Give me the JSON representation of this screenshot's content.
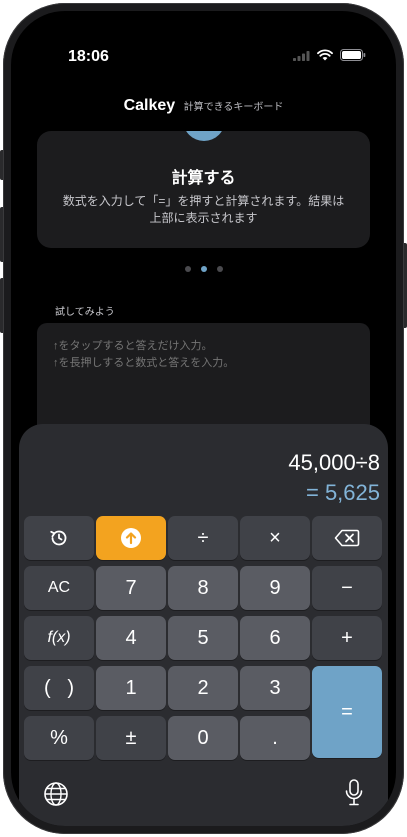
{
  "status": {
    "time": "18:06"
  },
  "header": {
    "title": "Calkey",
    "subtitle": "計算できるキーボード"
  },
  "tutorial": {
    "title": "計算する",
    "description": "数式を入力して「=」を押すと計算されます。結果は上部に表示されます",
    "page_count": 3,
    "active_page": 2
  },
  "try": {
    "label": "試してみよう",
    "placeholder": "↑をタップすると答えだけ入力。\n↑を長押しすると数式と答えを入力。"
  },
  "keyboard": {
    "expression": "45,000÷8",
    "result": "= 5,625",
    "keys": {
      "divide": "÷",
      "multiply": "×",
      "clear": "AC",
      "seven": "7",
      "eight": "8",
      "nine": "9",
      "minus": "−",
      "func": "f(x)",
      "four": "4",
      "five": "5",
      "six": "6",
      "plus": "+",
      "parens": "(   )",
      "one": "1",
      "two": "2",
      "three": "3",
      "equals": "=",
      "percent": "%",
      "plusminus": "±",
      "zero": "0",
      "decimal": "."
    }
  },
  "colors": {
    "accent": "#f3a31f",
    "result": "#82b4d8",
    "equals": "#6fa3c7",
    "keyboard_bg": "#2b2c30"
  }
}
